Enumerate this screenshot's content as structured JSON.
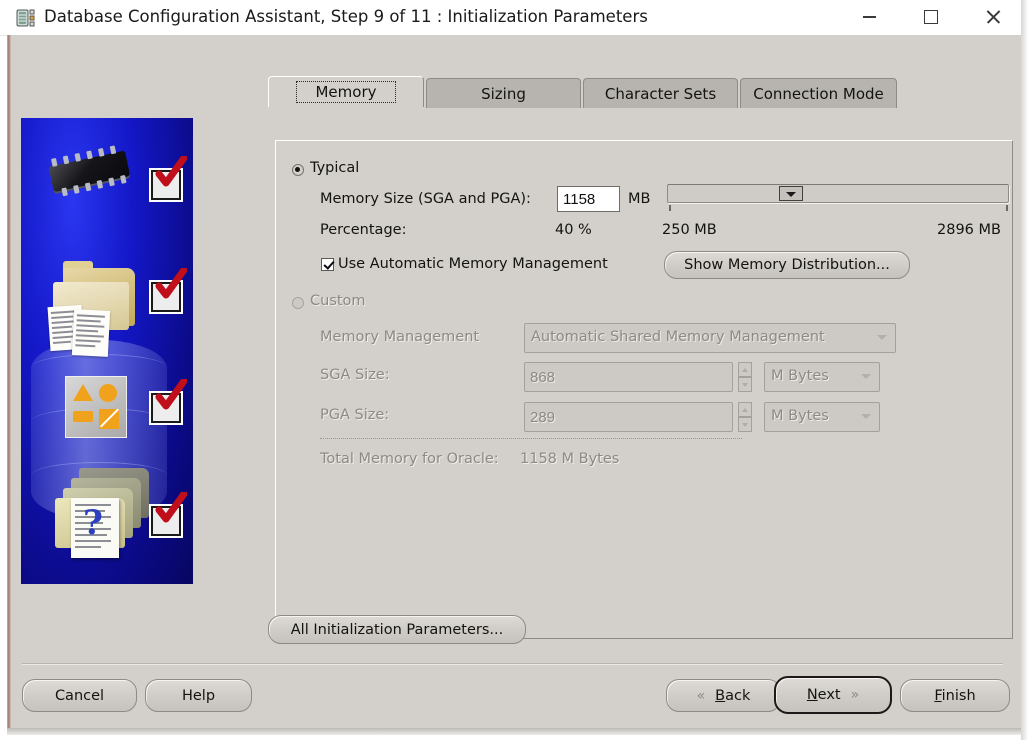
{
  "window": {
    "title": "Database Configuration Assistant, Step 9 of 11 : Initialization Parameters",
    "app_icon": "database-icon",
    "minimize_label": "—",
    "maximize_label": "□",
    "close_label": "✕"
  },
  "banner": {
    "alt": "Oracle database configuration artwork with four completed checkmarks",
    "items": [
      "chip-icon",
      "folder-documents-icon",
      "shapes-panel-icon",
      "folder-stack-question-icon"
    ],
    "check_count": 4
  },
  "tabs": [
    {
      "label": "Memory",
      "selected": true
    },
    {
      "label": "Sizing",
      "selected": false
    },
    {
      "label": "Character Sets",
      "selected": false
    },
    {
      "label": "Connection Mode",
      "selected": false
    }
  ],
  "memory": {
    "typical": {
      "label": "Typical",
      "selected": true,
      "memory_size_label": "Memory Size (SGA and PGA):",
      "memory_size_value": "1158",
      "memory_size_unit": "MB",
      "percentage_label": "Percentage:",
      "percentage_value": "40 %",
      "slider_min_label": "250 MB",
      "slider_max_label": "2896 MB",
      "slider_position_percent": 33,
      "auto_mem_label": "Use Automatic Memory Management",
      "auto_mem_checked": true,
      "show_distribution_label": "Show Memory Distribution..."
    },
    "custom": {
      "label": "Custom",
      "selected": false,
      "enabled": false,
      "memory_management_label": "Memory Management",
      "memory_management_value": "Automatic Shared Memory Management",
      "sga_label": "SGA Size:",
      "sga_value": "868",
      "sga_unit": "M Bytes",
      "pga_label": "PGA Size:",
      "pga_value": "289",
      "pga_unit": "M Bytes",
      "total_label": "Total Memory for Oracle:",
      "total_value": "1158 M Bytes"
    }
  },
  "actions": {
    "all_init_params": "All Initialization Parameters...",
    "cancel": "Cancel",
    "help": "Help",
    "back": "Back",
    "next": "Next",
    "finish": "Finish",
    "back_prefix": "B",
    "back_rest": "ack",
    "next_prefix": "N",
    "next_rest": "ext",
    "finish_prefix": "F",
    "finish_rest": "inish",
    "back_chevron": "«",
    "next_chevron": "»",
    "focused_button": "Next"
  },
  "colors": {
    "window_bg": "#d3d0cb",
    "banner_blue": "#1418c8",
    "accent_red": "#c00f1a",
    "tab_inactive": "#b7b4af",
    "disabled_text": "#8d8a85"
  }
}
